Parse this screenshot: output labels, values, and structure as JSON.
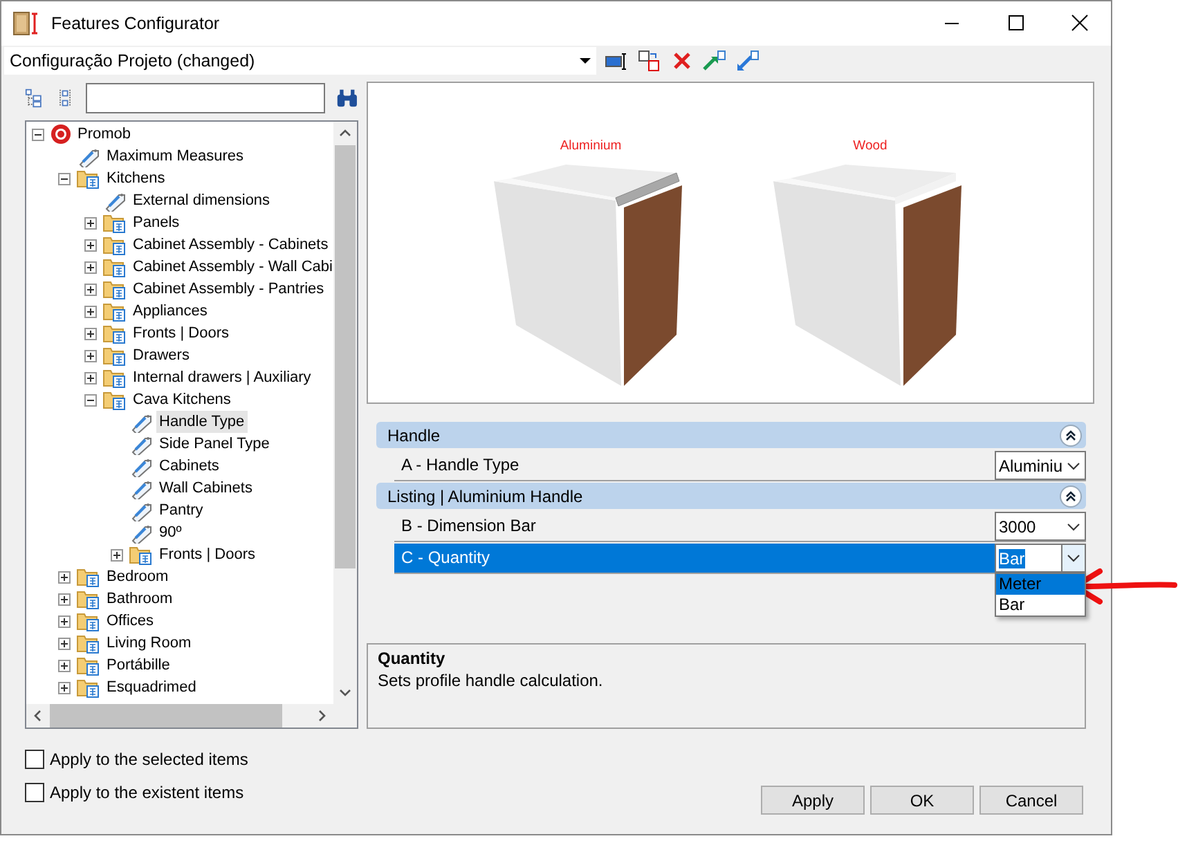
{
  "window": {
    "title": "Features Configurator"
  },
  "toolbar": {
    "configuration": "Configuração Projeto (changed)"
  },
  "tree": {
    "nodes": [
      {
        "label": "Promob",
        "kind": "root",
        "expanded": true,
        "selected": false,
        "children": [
          {
            "label": "Maximum Measures",
            "kind": "tag",
            "selected": false
          },
          {
            "label": "Kitchens",
            "kind": "folder",
            "expanded": true,
            "selected": false,
            "children": [
              {
                "label": "External dimensions",
                "kind": "tag",
                "selected": false
              },
              {
                "label": "Panels",
                "kind": "folder",
                "expanded": false,
                "selected": false
              },
              {
                "label": "Cabinet Assembly - Cabinets",
                "kind": "folder",
                "expanded": false,
                "selected": false
              },
              {
                "label": "Cabinet Assembly - Wall Cabi",
                "kind": "folder",
                "expanded": false,
                "selected": false
              },
              {
                "label": "Cabinet Assembly - Pantries",
                "kind": "folder",
                "expanded": false,
                "selected": false
              },
              {
                "label": "Appliances",
                "kind": "folder",
                "expanded": false,
                "selected": false
              },
              {
                "label": "Fronts | Doors",
                "kind": "folder",
                "expanded": false,
                "selected": false
              },
              {
                "label": "Drawers",
                "kind": "folder",
                "expanded": false,
                "selected": false
              },
              {
                "label": "Internal drawers | Auxiliary",
                "kind": "folder",
                "expanded": false,
                "selected": false
              },
              {
                "label": "Cava Kitchens",
                "kind": "folder",
                "expanded": true,
                "selected": false,
                "children": [
                  {
                    "label": "Handle Type",
                    "kind": "tag",
                    "selected": true
                  },
                  {
                    "label": "Side Panel Type",
                    "kind": "tag",
                    "selected": false
                  },
                  {
                    "label": "Cabinets",
                    "kind": "tag",
                    "selected": false
                  },
                  {
                    "label": "Wall Cabinets",
                    "kind": "tag",
                    "selected": false
                  },
                  {
                    "label": "Pantry",
                    "kind": "tag",
                    "selected": false
                  },
                  {
                    "label": "90º",
                    "kind": "tag",
                    "selected": false
                  },
                  {
                    "label": "Fronts | Doors",
                    "kind": "folder",
                    "expanded": false,
                    "selected": false
                  }
                ]
              }
            ]
          },
          {
            "label": "Bedroom",
            "kind": "folder",
            "expanded": false,
            "selected": false
          },
          {
            "label": "Bathroom",
            "kind": "folder",
            "expanded": false,
            "selected": false
          },
          {
            "label": "Offices",
            "kind": "folder",
            "expanded": false,
            "selected": false
          },
          {
            "label": "Living Room",
            "kind": "folder",
            "expanded": false,
            "selected": false
          },
          {
            "label": "Portábille",
            "kind": "folder",
            "expanded": false,
            "selected": false
          },
          {
            "label": "Esquadrimed",
            "kind": "folder",
            "expanded": false,
            "selected": false
          }
        ]
      }
    ]
  },
  "options": [
    {
      "label": "Apply to the selected items",
      "checked": false
    },
    {
      "label": "Apply to the existent items",
      "checked": false
    }
  ],
  "preview": {
    "items": [
      {
        "label": "Aluminium",
        "kind": "aluminium"
      },
      {
        "label": "Wood",
        "kind": "wood"
      }
    ]
  },
  "properties": {
    "groups": [
      {
        "title": "Handle",
        "expanded": true,
        "rows": [
          {
            "label": "A - Handle Type",
            "value": "Aluminiu",
            "selected": false,
            "dropdown_open": false
          }
        ]
      },
      {
        "title": "Listing | Aluminium Handle",
        "expanded": true,
        "rows": [
          {
            "label": "B - Dimension Bar",
            "value": "3000",
            "selected": false,
            "dropdown_open": false
          },
          {
            "label": "C - Quantity",
            "value": "Bar",
            "selected": true,
            "dropdown_open": true,
            "options": [
              {
                "label": "Meter",
                "highlighted": true
              },
              {
                "label": "Bar",
                "highlighted": false
              }
            ]
          }
        ]
      }
    ]
  },
  "description": {
    "title": "Quantity",
    "text": "Sets profile handle calculation."
  },
  "buttons": [
    "Apply",
    "OK",
    "Cancel"
  ]
}
